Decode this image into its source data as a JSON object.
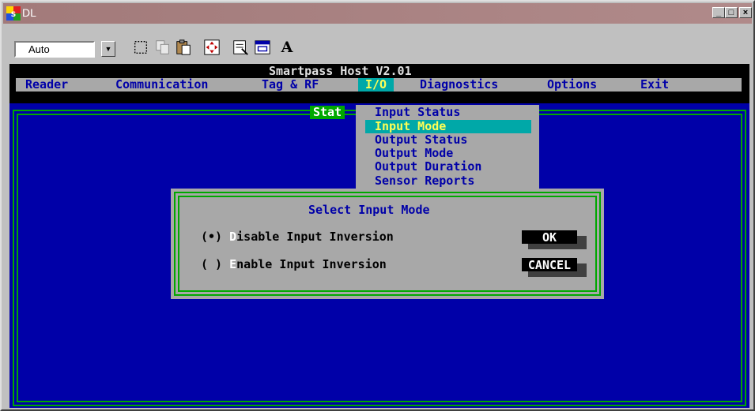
{
  "window": {
    "title": "DL",
    "controls": [
      "minimize",
      "maximize",
      "close"
    ]
  },
  "toolbar": {
    "font_size_value": "Auto",
    "font_label": "A",
    "icons": [
      "select-icon",
      "copy-icon",
      "paste-icon",
      "fullscreen-icon",
      "properties-icon",
      "background-icon",
      "font-icon"
    ]
  },
  "terminal": {
    "header_title": "Smartpass Host V2.01",
    "menu": [
      "Reader",
      "Communication",
      "Tag & RF",
      "I/O",
      "Diagnostics",
      "Options",
      "Exit"
    ],
    "menu_selected": "I/O",
    "status_tag": "Stat",
    "io_menu": [
      "Input Status",
      "Input Mode",
      "Output Status",
      "Output Mode",
      "Output Duration",
      "Sensor Reports"
    ],
    "io_menu_selected": "Input Mode",
    "dialog": {
      "title": "Select Input Mode",
      "options": [
        {
          "marker": "(•)",
          "hotkey": "D",
          "rest": "isable Input Inversion",
          "selected": true
        },
        {
          "marker": "( )",
          "hotkey": "E",
          "rest": "nable Input Inversion",
          "selected": false
        }
      ],
      "ok_label": "OK",
      "cancel_label": "CANCEL"
    }
  },
  "colors": {
    "titlebar": "#a27a7a",
    "terminal_blue": "#0000a8",
    "terminal_gray": "#a8a8a8",
    "highlight_teal": "#00a8a8",
    "border_green": "#00a800",
    "menu_text_blue": "#0000a8",
    "highlight_text_yellow": "#ffff55"
  }
}
